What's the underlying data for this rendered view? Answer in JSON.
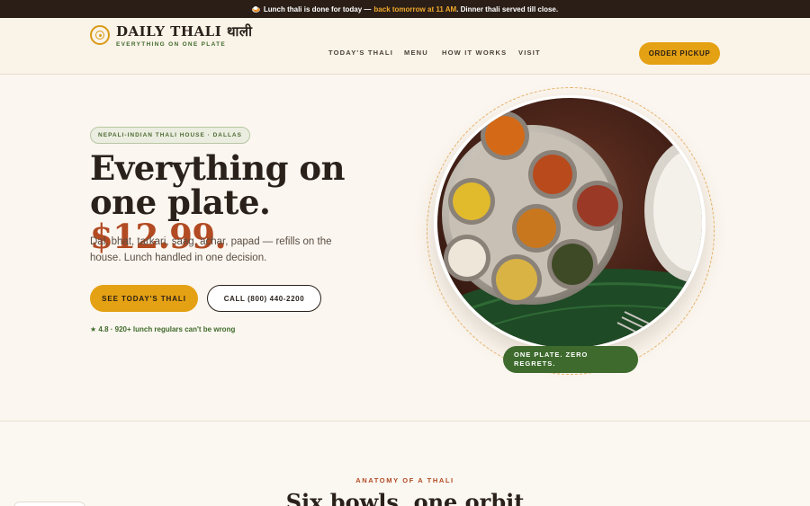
{
  "announcement": {
    "emoji": "🍛",
    "text_before": "Lunch thali is done for today —",
    "highlight": "back tomorrow at 11 AM",
    "text_after": ". Dinner thali served till close."
  },
  "brand": {
    "name": "DAILY THALI थाली",
    "tagline": "EVERYTHING ON ONE PLATE"
  },
  "nav": {
    "items": [
      "TODAY'S THALI",
      "MENU",
      "HOW IT WORKS",
      "VISIT"
    ],
    "cta": "ORDER PICKUP"
  },
  "hero": {
    "pill": "NEPALI-INDIAN THALI HOUSE · DALLAS",
    "headline_part1": "Everything on one plate.",
    "headline_price": "$12.99.",
    "subtext": "Dal, bhat, tarkari, saag, achar, papad — refills on the house. Lunch handled in one decision.",
    "primary_button": "SEE TODAY'S THALI",
    "secondary_button": "CALL (800) 440-2200",
    "rating": "★ 4.8 · 920+ lunch regulars can't be wrong",
    "badge": "ONE PLATE. ZERO REGRETS."
  },
  "section2": {
    "eyebrow": "ANATOMY OF A THALI",
    "title": "Six bowls, one orbit"
  },
  "colors": {
    "accent": "#e4a113",
    "brand_red": "#b24a22",
    "green": "#3e6b2d",
    "dark": "#2a1e17",
    "background": "#fbf6ef"
  }
}
